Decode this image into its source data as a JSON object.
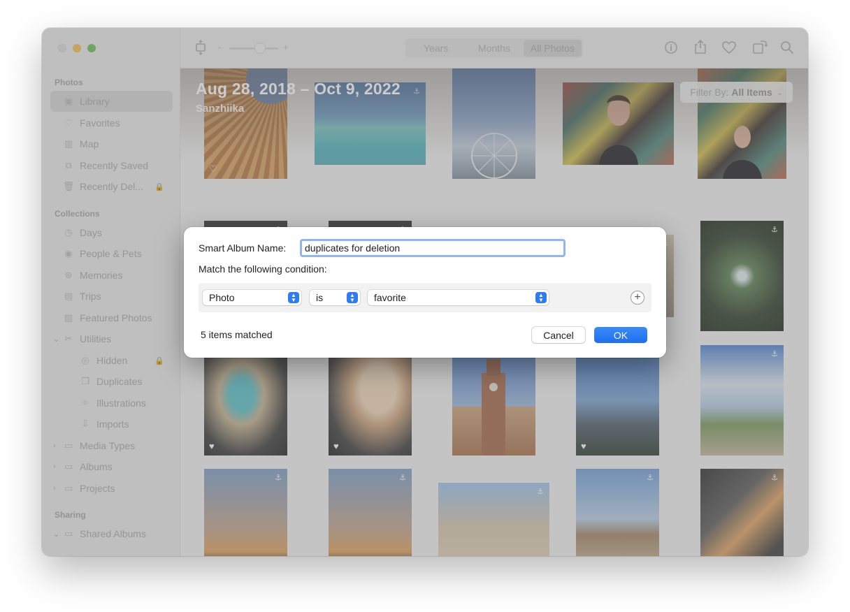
{
  "window": {
    "traffic_lights": [
      "close",
      "minimize",
      "zoom"
    ]
  },
  "sidebar": {
    "sections": [
      {
        "title": "Photos",
        "items": [
          {
            "label": "Library",
            "icon": "photo-library-icon",
            "selected": true
          },
          {
            "label": "Favorites",
            "icon": "heart-icon"
          },
          {
            "label": "Map",
            "icon": "map-icon"
          },
          {
            "label": "Recently Saved",
            "icon": "recently-saved-icon"
          },
          {
            "label": "Recently Del...",
            "icon": "trash-icon",
            "locked": true
          }
        ]
      },
      {
        "title": "Collections",
        "items": [
          {
            "label": "Days",
            "icon": "clock-icon"
          },
          {
            "label": "People & Pets",
            "icon": "person-icon"
          },
          {
            "label": "Memories",
            "icon": "memories-icon"
          },
          {
            "label": "Trips",
            "icon": "suitcase-icon"
          },
          {
            "label": "Featured Photos",
            "icon": "featured-photos-icon"
          },
          {
            "label": "Utilities",
            "icon": "utilities-icon",
            "expanded": true
          },
          {
            "label": "Hidden",
            "icon": "eye-slash-icon",
            "sub": true,
            "locked": true
          },
          {
            "label": "Duplicates",
            "icon": "duplicates-icon",
            "sub": true
          },
          {
            "label": "Illustrations",
            "icon": "illustrations-icon",
            "sub": true
          },
          {
            "label": "Imports",
            "icon": "imports-icon",
            "sub": true
          },
          {
            "label": "Media Types",
            "icon": "folder-icon",
            "collapsed": true
          },
          {
            "label": "Albums",
            "icon": "folder-icon",
            "collapsed": true
          },
          {
            "label": "Projects",
            "icon": "folder-icon",
            "collapsed": true
          }
        ]
      },
      {
        "title": "Sharing",
        "items": [
          {
            "label": "Shared Albums",
            "icon": "shared-albums-icon",
            "expanded": true
          }
        ]
      }
    ]
  },
  "toolbar": {
    "view_tabs": [
      "Years",
      "Months",
      "All Photos"
    ],
    "active_tab": "All Photos",
    "zoom_minus": "-",
    "zoom_plus": "+",
    "right_icons": [
      "info-icon",
      "share-icon",
      "heart-icon",
      "rotate-icon",
      "search-icon"
    ]
  },
  "library": {
    "date_range": "Aug 28, 2018 – Oct 9, 2022",
    "location": "Sanzhiika",
    "filter_prefix": "Filter By:",
    "filter_value": "All Items"
  },
  "dialog": {
    "name_label": "Smart Album Name:",
    "name_value": "duplicates for deletion",
    "condition_heading": "Match the following condition:",
    "condition": {
      "field": "Photo",
      "operator": "is",
      "value": "favorite"
    },
    "add_label": "+",
    "match_count": "5 items matched",
    "cancel_label": "Cancel",
    "ok_label": "OK",
    "accent": "#2d7cf6"
  }
}
